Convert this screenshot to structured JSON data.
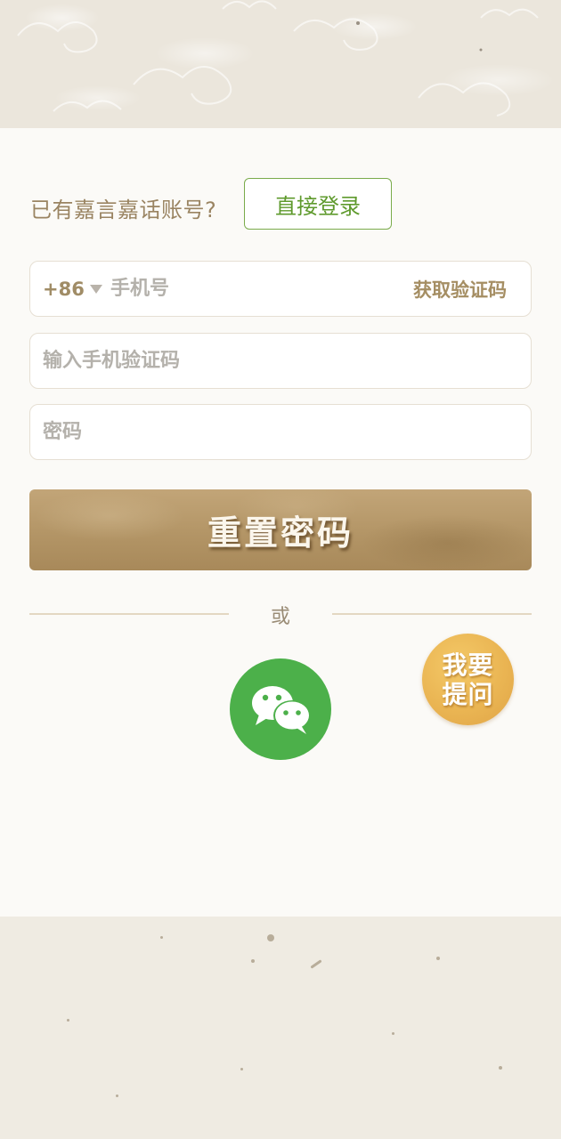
{
  "account_prompt": "已有嘉言嘉话账号?",
  "login_button": "直接登录",
  "phone": {
    "country_code": "+86",
    "placeholder": "手机号",
    "get_code": "获取验证码"
  },
  "code_field": {
    "placeholder": "输入手机验证码"
  },
  "password_field": {
    "placeholder": "密码"
  },
  "reset_button": "重置密码",
  "divider_text": "或",
  "ask_button": {
    "line1": "我要",
    "line2": "提问"
  },
  "colors": {
    "accent_green": "#5f9a2d",
    "wechat_green": "#4cb04a",
    "gold": "#eab553",
    "paper_brown": "#b39566"
  },
  "icons": {
    "wechat": "wechat-icon",
    "dropdown": "dropdown-triangle-icon"
  }
}
